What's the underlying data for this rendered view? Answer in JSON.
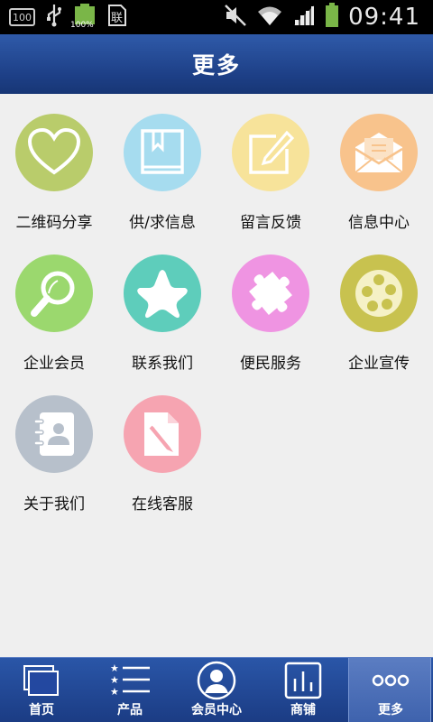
{
  "status_bar": {
    "battery_label": "100",
    "battery_pct": "100%",
    "time": "09:41"
  },
  "header": {
    "title": "更多"
  },
  "grid": [
    {
      "label": "二维码分享",
      "icon": "heart-icon",
      "color": "#b9cc6b"
    },
    {
      "label": "供/求信息",
      "icon": "book-icon",
      "color": "#a6dcef"
    },
    {
      "label": "留言反馈",
      "icon": "note-edit-icon",
      "color": "#f7e39a"
    },
    {
      "label": "信息中心",
      "icon": "mail-icon",
      "color": "#f8c38c"
    },
    {
      "label": "企业会员",
      "icon": "search-icon",
      "color": "#9bd86e"
    },
    {
      "label": "联系我们",
      "icon": "star-icon",
      "color": "#5ecdbb"
    },
    {
      "label": "便民服务",
      "icon": "puzzle-icon",
      "color": "#ef94e2"
    },
    {
      "label": "企业宣传",
      "icon": "film-reel-icon",
      "color": "#c8c24f"
    },
    {
      "label": "关于我们",
      "icon": "contact-book-icon",
      "color": "#b7c0cb"
    },
    {
      "label": "在线客服",
      "icon": "document-pen-icon",
      "color": "#f6a4b1"
    }
  ],
  "tabbar": {
    "items": [
      {
        "label": "首页",
        "icon": "home-icon"
      },
      {
        "label": "产品",
        "icon": "list-icon"
      },
      {
        "label": "会员中心",
        "icon": "user-icon"
      },
      {
        "label": "商铺",
        "icon": "chart-icon"
      },
      {
        "label": "更多",
        "icon": "more-icon"
      }
    ],
    "active_index": 4
  }
}
